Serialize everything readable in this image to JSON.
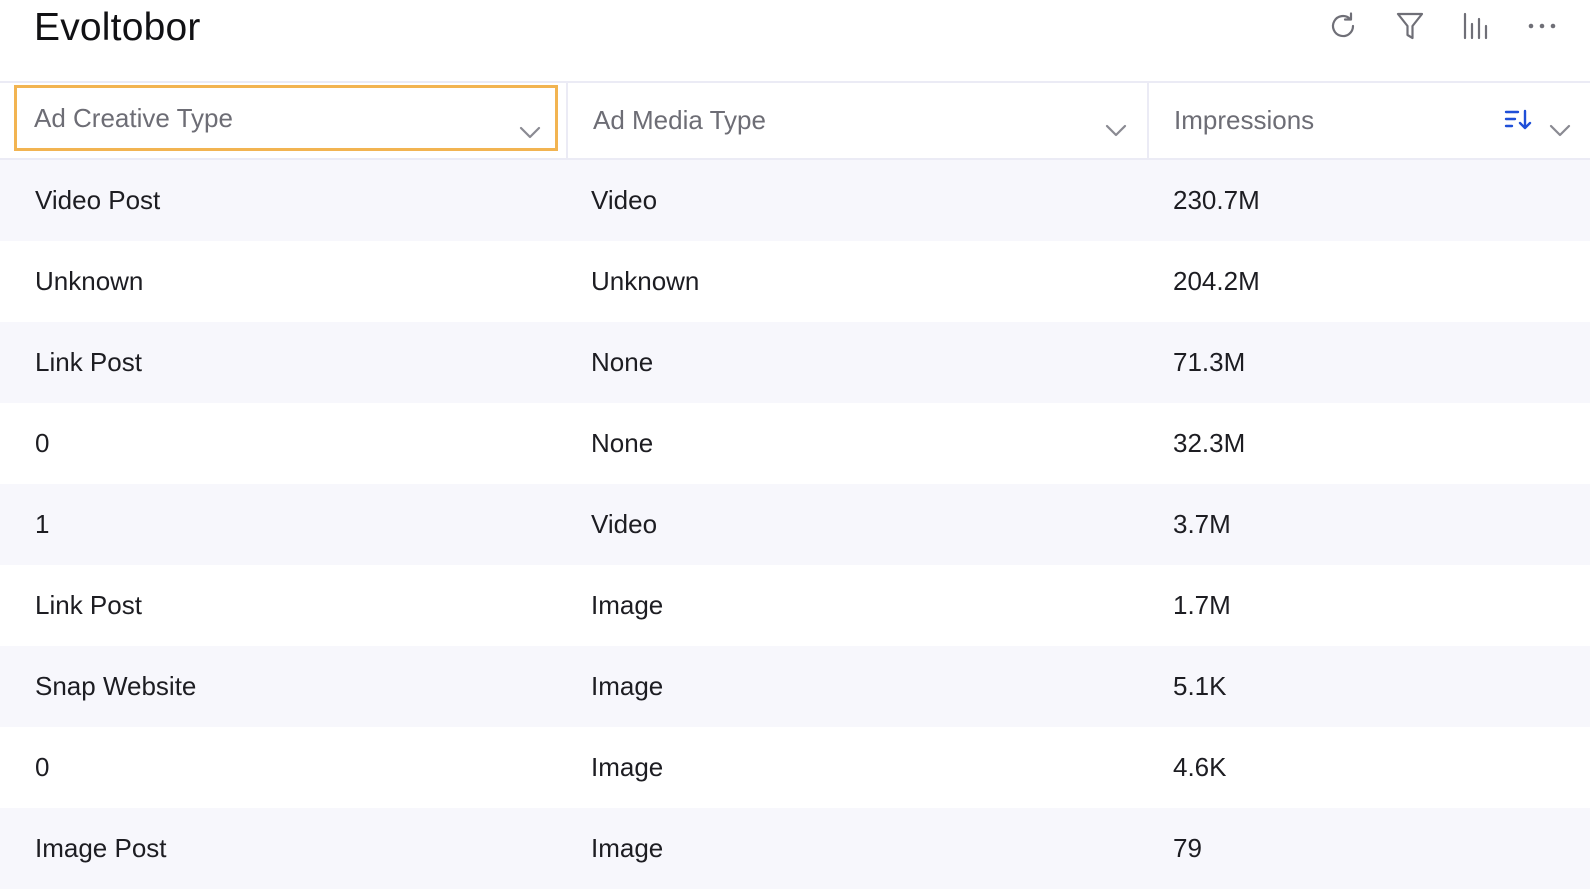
{
  "header": {
    "title": "Evoltobor",
    "toolbar": [
      {
        "icon": "refresh-icon"
      },
      {
        "icon": "filter-icon"
      },
      {
        "icon": "chart-bars-icon"
      },
      {
        "icon": "more-horizontal-icon"
      }
    ]
  },
  "table": {
    "columns": [
      {
        "label": "Ad Creative Type",
        "focused": true,
        "focus_color": "#f2b451"
      },
      {
        "label": "Ad Media Type"
      },
      {
        "label": "Impressions",
        "sorted": "descending",
        "sort_color": "#1f4fd8"
      }
    ],
    "rows": [
      [
        "Video Post",
        "Video",
        "230.7M"
      ],
      [
        "Unknown",
        "Unknown",
        "204.2M"
      ],
      [
        "Link Post",
        "None",
        "71.3M"
      ],
      [
        "0",
        "None",
        "32.3M"
      ],
      [
        "1",
        "Video",
        "3.7M"
      ],
      [
        "Link Post",
        "Image",
        "1.7M"
      ],
      [
        "Snap Website",
        "Image",
        "5.1K"
      ],
      [
        "0",
        "Image",
        "4.6K"
      ],
      [
        "Image Post",
        "Image",
        "79"
      ]
    ]
  }
}
